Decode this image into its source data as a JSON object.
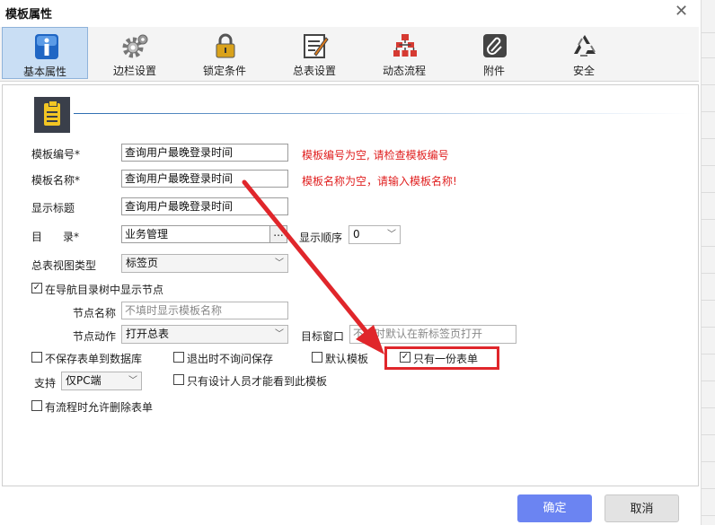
{
  "window": {
    "title": "模板属性"
  },
  "tabs": [
    {
      "label": "基本属性",
      "icon": "info-icon"
    },
    {
      "label": "边栏设置",
      "icon": "gear-icon"
    },
    {
      "label": "锁定条件",
      "icon": "lock-icon"
    },
    {
      "label": "总表设置",
      "icon": "edit-sheet-icon"
    },
    {
      "label": "动态流程",
      "icon": "flow-icon"
    },
    {
      "label": "附件",
      "icon": "paperclip-icon"
    },
    {
      "label": "安全",
      "icon": "recycle-icon"
    }
  ],
  "form": {
    "template_no": {
      "label": "模板编号*",
      "value": "查询用户最晚登录时间",
      "error": "模板编号为空, 请检查模板编号"
    },
    "template_name": {
      "label": "模板名称*",
      "value": "查询用户最晚登录时间",
      "error": "模板名称为空，请输入模板名称!"
    },
    "display_title": {
      "label": "显示标题",
      "value": "查询用户最晚登录时间"
    },
    "directory": {
      "label_a": "目",
      "label_b": "录*",
      "value": "业务管理",
      "browse": "..."
    },
    "display_order": {
      "label": "显示顺序",
      "value": "0"
    },
    "view_type": {
      "label": "总表视图类型",
      "value": "标签页"
    },
    "show_in_nav": {
      "label": "在导航目录树中显示节点",
      "checked": true
    },
    "node_name": {
      "label": "节点名称",
      "placeholder": "不填时显示模板名称"
    },
    "node_action": {
      "label": "节点动作",
      "value": "打开总表"
    },
    "target_window": {
      "label": "目标窗口",
      "placeholder": "不填时默认在新标签页打开"
    },
    "no_save_to_db": {
      "label": "不保存表单到数据库",
      "checked": false
    },
    "exit_no_ask": {
      "label": "退出时不询问保存",
      "checked": false
    },
    "default_template": {
      "label": "默认模板",
      "checked": false
    },
    "single_form": {
      "label": "只有一份表单",
      "checked": true
    },
    "support": {
      "label": "支持",
      "value": "仅PC端"
    },
    "designer_only": {
      "label": "只有设计人员才能看到此模板",
      "checked": false
    },
    "allow_delete_in_flow": {
      "label": "有流程时允许删除表单",
      "checked": false
    }
  },
  "buttons": {
    "ok": "确定",
    "cancel": "取消"
  },
  "colors": {
    "accent": "#6b84f2",
    "error": "#e02020",
    "highlight": "#e0262b",
    "active_tab": "#c9def4"
  }
}
